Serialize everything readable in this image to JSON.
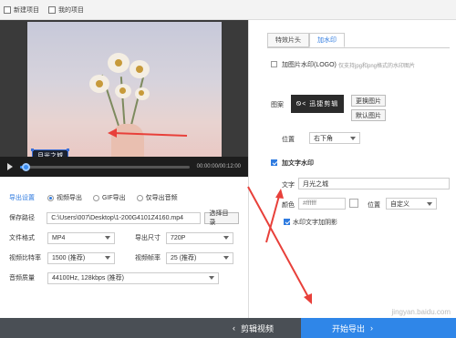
{
  "topbar": {
    "new_project": "新建项目",
    "my_projects": "我的项目"
  },
  "video": {
    "caption": "月光之城",
    "time_current": "00:00:00",
    "time_total": "00:12:00",
    "progress_fraction": 0.03
  },
  "settings": {
    "export_label": "导出设置",
    "export_options": [
      "视频导出",
      "GIF导出",
      "仅导出音频"
    ],
    "export_selected": 0,
    "path_label": "保存路径",
    "path_value": "C:\\Users\\007\\Desktop\\1-200G4101Z4160.mp4",
    "path_button": "选择目录",
    "format_label": "文件格式",
    "format_value": "MP4",
    "size_label": "导出尺寸",
    "size_value": "720P",
    "bitrate_label": "视频比特率",
    "bitrate_value": "1500 (推荐)",
    "framerate_label": "视频帧率",
    "framerate_value": "25 (推荐)",
    "audio_label": "音频质量",
    "audio_value": "44100Hz, 128kbps (推荐)"
  },
  "right": {
    "tabs": [
      "特效片头",
      "加水印"
    ],
    "active_tab": 1,
    "image_wm_label": "加图片水印(LOGO)",
    "image_wm_hint": "仅支持jpg和png格式的水印图片",
    "image_wm_checked": false,
    "icon_label": "图案",
    "logo_text": "Ꮻ< 迅捷剪辑",
    "change_image": "更换图片",
    "default_image": "默认图片",
    "position_label": "位置",
    "position_value": "右下角",
    "text_wm_label": "加文字水印",
    "text_wm_checked": true,
    "text_label": "文字",
    "text_value": "月光之城",
    "color_label": "颜色",
    "color_value": "#ffffff",
    "text_position_label": "位置",
    "text_position_value": "自定义",
    "shadow_label": "水印文字加阴影",
    "shadow_checked": true
  },
  "bottom": {
    "edit_video": "剪辑视频",
    "start_export": "开始导出"
  },
  "watermark_site": "jingyan.baidu.com",
  "colors": {
    "accent": "#2f86e8",
    "arrow": "#e8403a",
    "dark_bar": "#4a4f55"
  }
}
